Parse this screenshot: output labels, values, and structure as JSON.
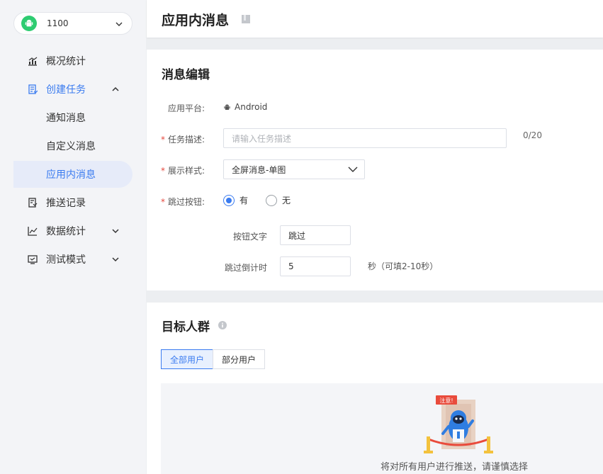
{
  "app": {
    "name": "1100",
    "icon": "android-icon"
  },
  "sidebar": {
    "items": [
      {
        "label": "概况统计",
        "icon": "stats-icon"
      },
      {
        "label": "创建任务",
        "icon": "task-icon",
        "expanded": true
      },
      {
        "label": "通知消息"
      },
      {
        "label": "自定义消息"
      },
      {
        "label": "应用内消息",
        "active": true
      },
      {
        "label": "推送记录",
        "icon": "record-icon"
      },
      {
        "label": "数据统计",
        "icon": "chart-icon"
      },
      {
        "label": "测试模式",
        "icon": "test-icon"
      }
    ]
  },
  "header": {
    "title": "应用内消息"
  },
  "editor": {
    "title": "消息编辑",
    "platform": {
      "label": "应用平台:",
      "value": "Android"
    },
    "description": {
      "label": "任务描述:",
      "placeholder": "请输入任务描述",
      "counter": "0/20"
    },
    "style": {
      "label": "展示样式:",
      "value": "全屏消息-单图"
    },
    "skip": {
      "label": "跳过按钮:",
      "yes": "有",
      "no": "无",
      "selected": "有"
    },
    "button_text": {
      "label": "按钮文字",
      "value": "跳过"
    },
    "countdown": {
      "label": "跳过倒计时",
      "value": "5",
      "hint": "秒（可填2-10秒）"
    }
  },
  "audience": {
    "title": "目标人群",
    "tabs": [
      "全部用户",
      "部分用户"
    ],
    "selected_tab": "全部用户",
    "illustration_badge": "注意!",
    "empty_text": "将对所有用户进行推送，请谨慎选择"
  },
  "colors": {
    "accent": "#3a7bf0",
    "required": "#e5483e",
    "android": "#2ecc71"
  }
}
